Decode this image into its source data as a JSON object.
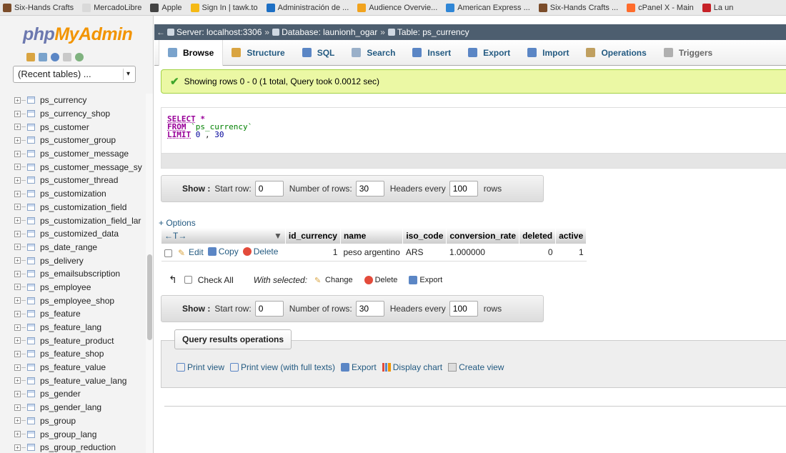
{
  "bookmarks": [
    {
      "label": "Six-Hands Crafts",
      "color": "#7b4c2a"
    },
    {
      "label": "MercadoLibre",
      "color": "#d9d9d9"
    },
    {
      "label": "Apple",
      "color": "#444444"
    },
    {
      "label": "Sign In | tawk.to",
      "color": "#f5b915"
    },
    {
      "label": "Administración de ...",
      "color": "#1d6fc4"
    },
    {
      "label": "Audience Overvie...",
      "color": "#f1a31e"
    },
    {
      "label": "American Express ...",
      "color": "#2f86d6"
    },
    {
      "label": "Six-Hands Crafts ...",
      "color": "#7b4c2a"
    },
    {
      "label": "cPanel X - Main",
      "color": "#ff6c2c"
    },
    {
      "label": "La un",
      "color": "#c62127"
    }
  ],
  "logo": {
    "php": "php",
    "myadmin": "MyAdmin"
  },
  "recent_tables": "(Recent tables) ...",
  "tables": [
    "ps_currency",
    "ps_currency_shop",
    "ps_customer",
    "ps_customer_group",
    "ps_customer_message",
    "ps_customer_message_sy",
    "ps_customer_thread",
    "ps_customization",
    "ps_customization_field",
    "ps_customization_field_lar",
    "ps_customized_data",
    "ps_date_range",
    "ps_delivery",
    "ps_emailsubscription",
    "ps_employee",
    "ps_employee_shop",
    "ps_feature",
    "ps_feature_lang",
    "ps_feature_product",
    "ps_feature_shop",
    "ps_feature_value",
    "ps_feature_value_lang",
    "ps_gender",
    "ps_gender_lang",
    "ps_group",
    "ps_group_lang",
    "ps_group_reduction"
  ],
  "breadcrumb": {
    "server": "Server: localhost:3306",
    "database": "Database: launionh_ogar",
    "table": "Table: ps_currency"
  },
  "tabs": [
    "Browse",
    "Structure",
    "SQL",
    "Search",
    "Insert",
    "Export",
    "Import",
    "Operations",
    "Triggers"
  ],
  "message": "Showing rows 0 - 0 (1 total, Query took 0.0012 sec)",
  "sql": {
    "select": "SELECT",
    "star": "*",
    "from": "FROM",
    "table": "`ps_currency`",
    "limit": "LIMIT",
    "offset": "0",
    "comma": ",",
    "count": "30"
  },
  "nav": {
    "show": "Show :",
    "start_row_label": "Start row:",
    "start_row": "0",
    "num_rows_label": "Number of rows:",
    "num_rows": "30",
    "headers_label": "Headers every",
    "headers": "100",
    "rows": "rows"
  },
  "options_link": "+ Options",
  "columns": [
    "id_currency",
    "name",
    "iso_code",
    "conversion_rate",
    "deleted",
    "active"
  ],
  "rows": [
    {
      "id_currency": "1",
      "name": "peso argentino",
      "iso_code": "ARS",
      "conversion_rate": "1.000000",
      "deleted": "0",
      "active": "1"
    }
  ],
  "row_actions": {
    "edit": "Edit",
    "copy": "Copy",
    "delete": "Delete"
  },
  "with_selected": {
    "check_all": "Check All",
    "label": "With selected:",
    "change": "Change",
    "delete": "Delete",
    "export": "Export"
  },
  "qro": {
    "legend": "Query results operations",
    "print_view": "Print view",
    "print_view_full": "Print view (with full texts)",
    "export": "Export",
    "display_chart": "Display chart",
    "create_view": "Create view"
  }
}
